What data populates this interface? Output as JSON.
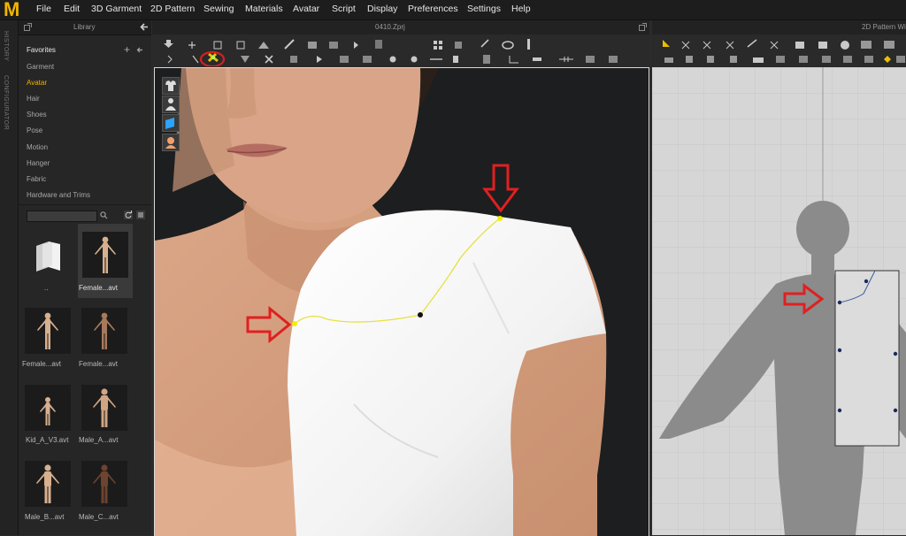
{
  "app": {
    "logo": "M"
  },
  "menu": [
    "File",
    "Edit",
    "3D Garment",
    "2D Pattern",
    "Sewing",
    "Materials",
    "Avatar",
    "Script",
    "Display",
    "Preferences",
    "Settings",
    "Help"
  ],
  "side_tabs": [
    "HISTORY",
    "CONFIGURATOR"
  ],
  "library": {
    "title": "Library",
    "categories": [
      "Favorites",
      "Garment",
      "Avatar",
      "Hair",
      "Shoes",
      "Pose",
      "Motion",
      "Hanger",
      "Fabric",
      "Hardware and Trims"
    ],
    "selected_category": "Avatar",
    "items": [
      {
        "label": ".."
      },
      {
        "label": "Female...avt"
      },
      {
        "label": "Female...avt"
      },
      {
        "label": "Female...avt"
      },
      {
        "label": "Kid_A_V3.avt"
      },
      {
        "label": "Male_A...avt"
      },
      {
        "label": "Male_B...avt"
      },
      {
        "label": "Male_C...avt"
      }
    ]
  },
  "view3d": {
    "title": "0410.Zprj"
  },
  "view2d": {
    "title": "2D Pattern Wi"
  },
  "colors": {
    "accent": "#f0b400",
    "highlight_ring": "#d42020",
    "arrow": "#e02020",
    "seam": "#e8e040"
  },
  "icons": [
    "add-icon",
    "collapse-icon",
    "search-icon",
    "refresh-icon",
    "list-view-icon",
    "window-icon"
  ]
}
